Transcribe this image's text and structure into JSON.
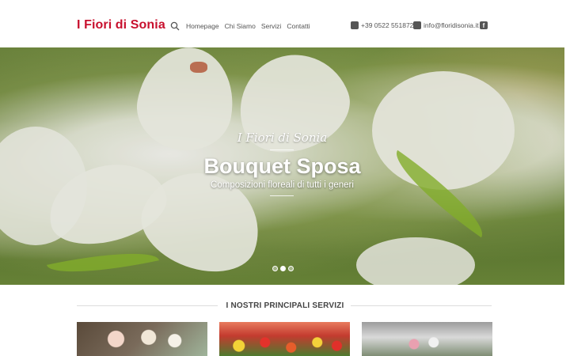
{
  "header": {
    "logo": "I Fiori di Sonia",
    "nav": [
      "Homepage",
      "Chi Siamo",
      "Servizi",
      "Contatti"
    ],
    "phone": "+39 0522 551872",
    "email": "info@floridisonia.it",
    "icons": {
      "search": "search-icon",
      "phone": "phone-icon",
      "mail": "mail-icon",
      "social": "facebook-icon"
    }
  },
  "hero": {
    "kicker": "I Fiori di Sonia",
    "title": "Bouquet Sposa",
    "subtitle": "Composizioni floreali di tutti i generi",
    "slides": 3,
    "active_slide": 2
  },
  "services": {
    "heading": "I NOSTRI PRINCIPALI SERVIZI"
  },
  "colors": {
    "brand": "#c8102e",
    "text": "#555555"
  }
}
